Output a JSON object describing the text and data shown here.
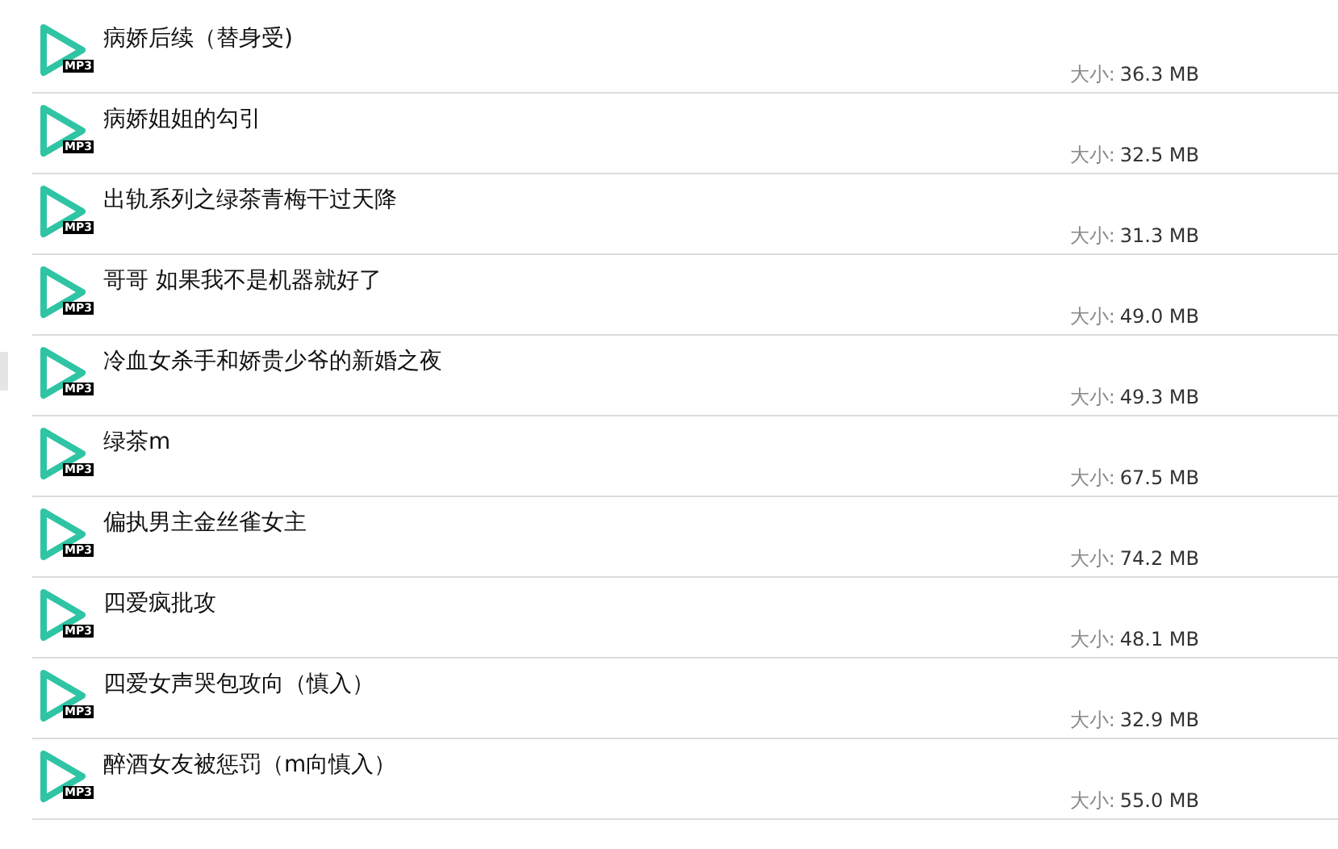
{
  "files": [
    {
      "title": "病娇后续（替身受)",
      "badge": "MP3",
      "size_label": "大小:",
      "size": "36.3 MB"
    },
    {
      "title": "病娇姐姐的勾引",
      "badge": "MP3",
      "size_label": "大小:",
      "size": "32.5 MB"
    },
    {
      "title": "出轨系列之绿茶青梅干过天降",
      "badge": "MP3",
      "size_label": "大小:",
      "size": "31.3 MB"
    },
    {
      "title": "哥哥 如果我不是机器就好了",
      "badge": "MP3",
      "size_label": "大小:",
      "size": "49.0 MB"
    },
    {
      "title": "冷血女杀手和娇贵少爷的新婚之夜",
      "badge": "MP3",
      "size_label": "大小:",
      "size": "49.3 MB"
    },
    {
      "title": "绿茶m",
      "badge": "MP3",
      "size_label": "大小:",
      "size": "67.5 MB"
    },
    {
      "title": "偏执男主金丝雀女主",
      "badge": "MP3",
      "size_label": "大小:",
      "size": "74.2 MB"
    },
    {
      "title": "四爱疯批攻",
      "badge": "MP3",
      "size_label": "大小:",
      "size": "48.1 MB"
    },
    {
      "title": "四爱女声哭包攻向（慎入）",
      "badge": "MP3",
      "size_label": "大小:",
      "size": "32.9 MB"
    },
    {
      "title": "醉酒女友被惩罚（m向慎入）",
      "badge": "MP3",
      "size_label": "大小:",
      "size": "55.0 MB"
    }
  ]
}
